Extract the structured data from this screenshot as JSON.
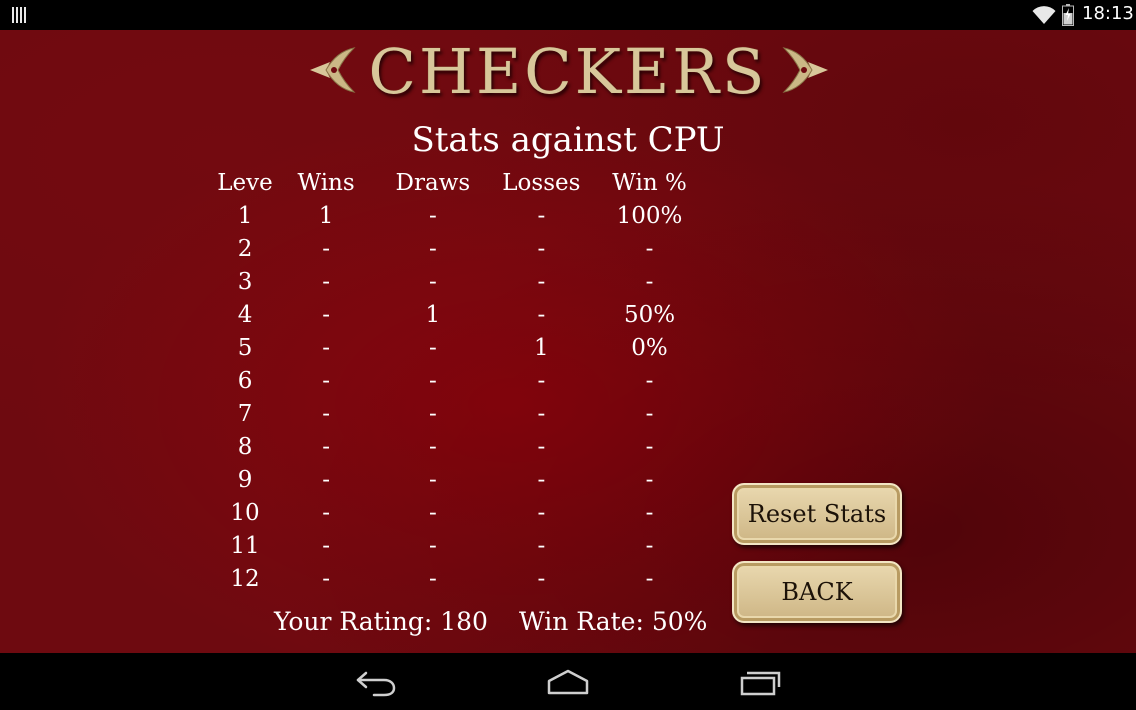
{
  "status_bar": {
    "time": "18:13",
    "icons": [
      "notification-icon",
      "wifi-icon",
      "battery-icon"
    ]
  },
  "logo": {
    "text": "CHECKERS"
  },
  "title": "Stats against CPU",
  "table": {
    "headers": [
      "Leve",
      "Wins",
      "Draws",
      "Losses",
      "Win %"
    ],
    "rows": [
      [
        "1",
        "1",
        "-",
        "-",
        "100%"
      ],
      [
        "2",
        "-",
        "-",
        "-",
        "-"
      ],
      [
        "3",
        "-",
        "-",
        "-",
        "-"
      ],
      [
        "4",
        "-",
        "1",
        "-",
        "50%"
      ],
      [
        "5",
        "-",
        "-",
        "1",
        "0%"
      ],
      [
        "6",
        "-",
        "-",
        "-",
        "-"
      ],
      [
        "7",
        "-",
        "-",
        "-",
        "-"
      ],
      [
        "8",
        "-",
        "-",
        "-",
        "-"
      ],
      [
        "9",
        "-",
        "-",
        "-",
        "-"
      ],
      [
        "10",
        "-",
        "-",
        "-",
        "-"
      ],
      [
        "11",
        "-",
        "-",
        "-",
        "-"
      ],
      [
        "12",
        "-",
        "-",
        "-",
        "-"
      ]
    ]
  },
  "footer": {
    "rating": "Your Rating: 180",
    "win_rate": "Win Rate: 50%"
  },
  "buttons": {
    "reset": "Reset Stats",
    "back": "BACK"
  },
  "nav_bar": {
    "icons": [
      "back-icon",
      "home-icon",
      "recents-icon"
    ]
  },
  "colors": {
    "background": "#6e0a10",
    "logo": "#d8c79a",
    "button": "#dcc79a",
    "text": "#ffffff"
  }
}
